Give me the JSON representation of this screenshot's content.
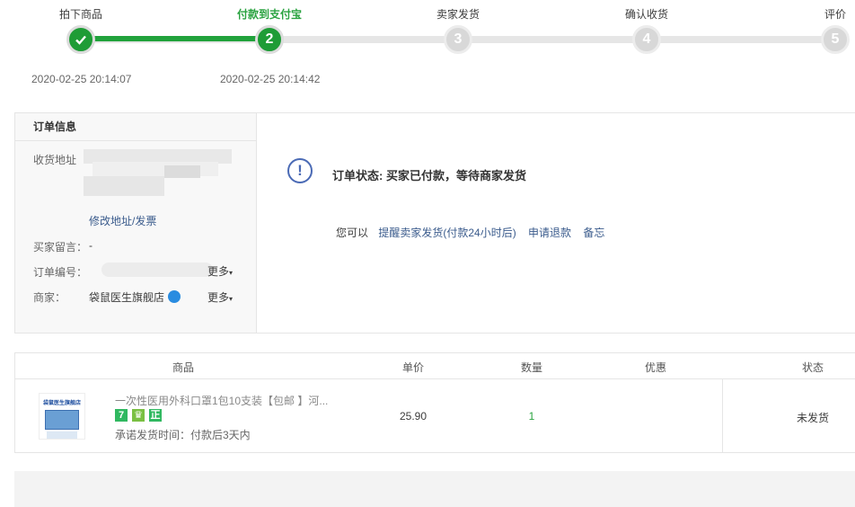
{
  "progress": {
    "steps": [
      {
        "label": "拍下商品",
        "num": "✓",
        "time": "2020-02-25 20:14:07"
      },
      {
        "label": "付款到支付宝",
        "num": "2",
        "time": "2020-02-25 20:14:42"
      },
      {
        "label": "卖家发货",
        "num": "3",
        "time": ""
      },
      {
        "label": "确认收货",
        "num": "4",
        "time": ""
      },
      {
        "label": "评价",
        "num": "5",
        "time": ""
      }
    ],
    "colors": {
      "done": "#1e9c36",
      "todo": "#d8d8d8",
      "active_text": "#2aa340"
    }
  },
  "order_info": {
    "title": "订单信息",
    "address_label": "收货地址",
    "edit_link": "修改地址/发票",
    "message_label": "买家留言：",
    "message_value": "-",
    "order_no_label": "订单编号：",
    "more1": "更多",
    "seller_label": "商家：",
    "seller_name": "袋鼠医生旗舰店",
    "more2": "更多"
  },
  "status": {
    "icon": "exclamation-circle-icon",
    "text": "订单状态: 买家已付款，等待商家发货",
    "you_can": "您可以",
    "action_remind": "提醒卖家发货(付款24小时后)",
    "action_refund": "申请退款",
    "action_memo": "备忘"
  },
  "goods_table": {
    "headers": {
      "product": "商品",
      "price": "单价",
      "qty": "数量",
      "discount": "优惠",
      "status": "状态"
    },
    "item": {
      "title": "一次性医用外科口罩1包10支装【包邮 】河...",
      "thumb_text": "袋鼠医生旗舰店",
      "tags": [
        "7",
        "♛",
        "正"
      ],
      "promise": "承诺发货时间：付款后3天内",
      "price": "25.90",
      "qty": "1",
      "discount": "",
      "status": "未发货"
    }
  }
}
